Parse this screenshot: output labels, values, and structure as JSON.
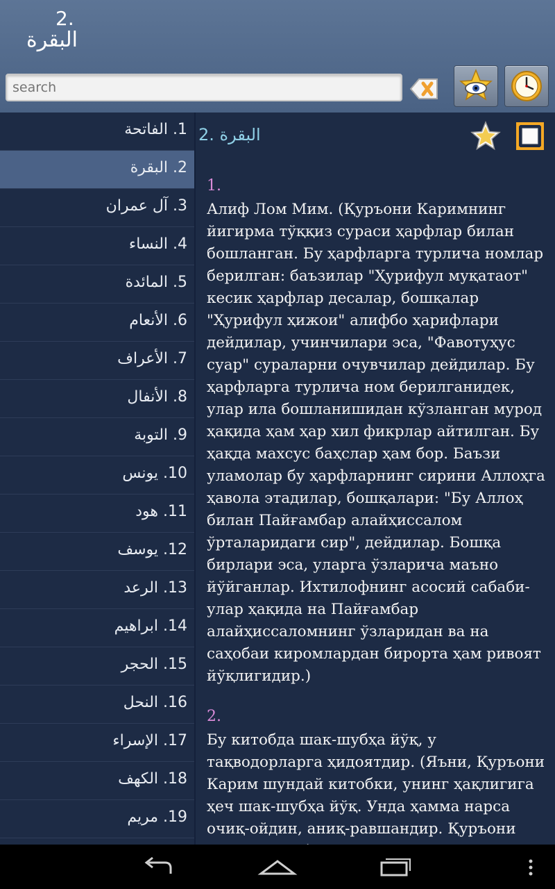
{
  "header": {
    "title_number": "2.",
    "title_name": "البقرة"
  },
  "search": {
    "placeholder": "search"
  },
  "toolbar": {
    "icons": [
      "clear-search-icon",
      "bookmark-star-eye-icon",
      "history-clock-icon"
    ]
  },
  "sidebar": {
    "items": [
      {
        "label": "1. الفاتحة"
      },
      {
        "label": "2. البقرة",
        "active": true
      },
      {
        "label": "3. آل عمران"
      },
      {
        "label": "4. النساء"
      },
      {
        "label": "5. المائدة"
      },
      {
        "label": "6. الأنعام"
      },
      {
        "label": "7. الأعراف"
      },
      {
        "label": "8. الأنفال"
      },
      {
        "label": "9. التوبة"
      },
      {
        "label": "10. يونس"
      },
      {
        "label": "11. هود"
      },
      {
        "label": "12. يوسف"
      },
      {
        "label": "13. الرعد"
      },
      {
        "label": "14. ابراهيم"
      },
      {
        "label": "15. الحجر"
      },
      {
        "label": "16. النحل"
      },
      {
        "label": "17. الإسراء"
      },
      {
        "label": "18. الكهف"
      },
      {
        "label": "19. مريم"
      }
    ]
  },
  "content": {
    "title": "2. البقرة",
    "ayahs": [
      {
        "num": "1.",
        "text": "Алиф Лом Мим. (Қуръони Каримнинг йигирма тўққиз сураси ҳарфлар билан бошланган. Бу ҳарфларга турлича номлар берилган: баъзилар \"Ҳурифул муқатаот\" кесик ҳарфлар десалар, бошқалар \"Ҳурифул ҳижои\" алифбо ҳарифлари дейдилар, учинчилари эса, \"Фавотуҳус суар\" сураларни очувчилар дейдилар. Бу ҳарфларга турлича ном берилганидек, улар ила бошланишидан кўзланган мурод ҳақида ҳам ҳар хил фикрлар айтилган. Бу ҳақда махсус баҳслар ҳам бор. Баъзи уламолар бу ҳарфларнинг сирини Аллоҳга ҳавола этадилар, бошқалари: \"Бу Аллоҳ билан Пайғамбар алайҳиссалом ўрталаридаги сир\", дейдилар. Бошқа бирлари эса, уларга ўзларича маъно йўйганлар. Ихтилофнинг асосий сабаби-улар ҳақида на Пайғамбар алайҳиссаломнинг ўзларидан ва на саҳобаи киромлардан бирорта ҳам ривоят йўқлигидир.)"
      },
      {
        "num": "2.",
        "text": "Бу китобда шак-шубҳа йўқ, у тақводорларга ҳидоятдир. (Яъни, Қуръони Карим шундай китобки, унинг ҳақлигига ҳеч шак-шубҳа йўқ. Унда ҳамма нарса очиқ-ойдин, аниқ-равшандир. Қуръони Каримнинг бир"
      }
    ]
  },
  "navbar": {
    "icons": [
      "back-icon",
      "home-icon",
      "recent-apps-icon",
      "overflow-menu-icon"
    ]
  },
  "colors": {
    "accent_title": "#8fd0e6",
    "ayah_number": "#d98bd8",
    "active_item": "#4b6287",
    "background": "#1d2b45"
  }
}
